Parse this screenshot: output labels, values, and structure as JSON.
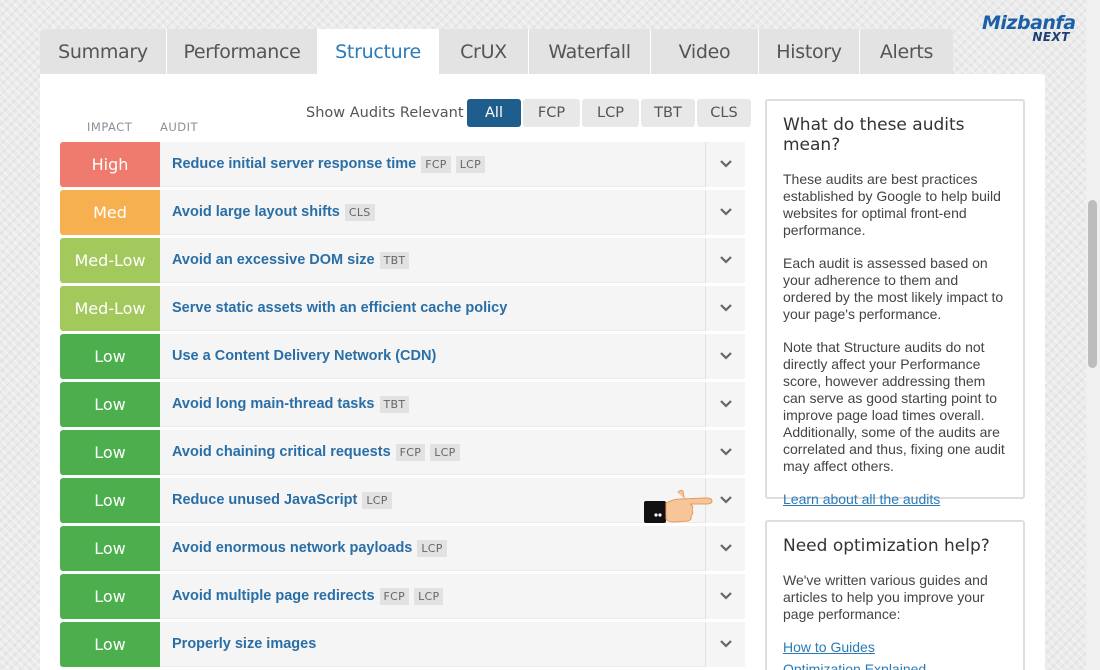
{
  "logo": {
    "brand": "Mizbanfa",
    "sub": "NEXT"
  },
  "tabs": [
    {
      "label": "Summary",
      "active": false
    },
    {
      "label": "Performance",
      "active": false
    },
    {
      "label": "Structure",
      "active": true
    },
    {
      "label": "CrUX",
      "active": false
    },
    {
      "label": "Waterfall",
      "active": false
    },
    {
      "label": "Video",
      "active": false
    },
    {
      "label": "History",
      "active": false
    },
    {
      "label": "Alerts",
      "active": false
    }
  ],
  "headers": {
    "impact": "IMPACT",
    "audit": "AUDIT"
  },
  "filter": {
    "label": "Show Audits Relevant to",
    "options": [
      "All",
      "FCP",
      "LCP",
      "TBT",
      "CLS"
    ],
    "selected": "All"
  },
  "colors": {
    "high": "#ef7a6e",
    "med": "#f6b04f",
    "med_low": "#a3c85b",
    "low": "#4cae4c",
    "accent": "#1f5d8c",
    "link": "#2a6ea6"
  },
  "audits": [
    {
      "impact": "High",
      "level": "high",
      "title": "Reduce initial server response time",
      "tags": [
        "FCP",
        "LCP"
      ]
    },
    {
      "impact": "Med",
      "level": "med",
      "title": "Avoid large layout shifts",
      "tags": [
        "CLS"
      ]
    },
    {
      "impact": "Med-Low",
      "level": "med_low",
      "title": "Avoid an excessive DOM size",
      "tags": [
        "TBT"
      ]
    },
    {
      "impact": "Med-Low",
      "level": "med_low",
      "title": "Serve static assets with an efficient cache policy",
      "tags": []
    },
    {
      "impact": "Low",
      "level": "low",
      "title": "Use a Content Delivery Network (CDN)",
      "tags": []
    },
    {
      "impact": "Low",
      "level": "low",
      "title": "Avoid long main-thread tasks",
      "tags": [
        "TBT"
      ]
    },
    {
      "impact": "Low",
      "level": "low",
      "title": "Avoid chaining critical requests",
      "tags": [
        "FCP",
        "LCP"
      ]
    },
    {
      "impact": "Low",
      "level": "low",
      "title": "Reduce unused JavaScript",
      "tags": [
        "LCP"
      ]
    },
    {
      "impact": "Low",
      "level": "low",
      "title": "Avoid enormous network payloads",
      "tags": [
        "LCP"
      ]
    },
    {
      "impact": "Low",
      "level": "low",
      "title": "Avoid multiple page redirects",
      "tags": [
        "FCP",
        "LCP"
      ]
    },
    {
      "impact": "Low",
      "level": "low",
      "title": "Properly size images",
      "tags": []
    }
  ],
  "sidebar": {
    "about": {
      "heading": "What do these audits mean?",
      "p1": "These audits are best practices established by Google to help build websites for optimal front-end performance.",
      "p2": "Each audit is assessed based on your adherence to them and ordered by the most likely impact to your page's performance.",
      "p3": "Note that Structure audits do not directly affect your Performance score, however addressing them can serve as good starting point to improve page load times overall. Additionally, some of the audits are correlated and thus, fixing one audit may affect others.",
      "link": "Learn about all the audits"
    },
    "help": {
      "heading": "Need optimization help?",
      "p1": "We've written various guides and articles to help you improve your page performance:",
      "link1": "How to Guides",
      "link2": "Optimization Explained"
    }
  }
}
